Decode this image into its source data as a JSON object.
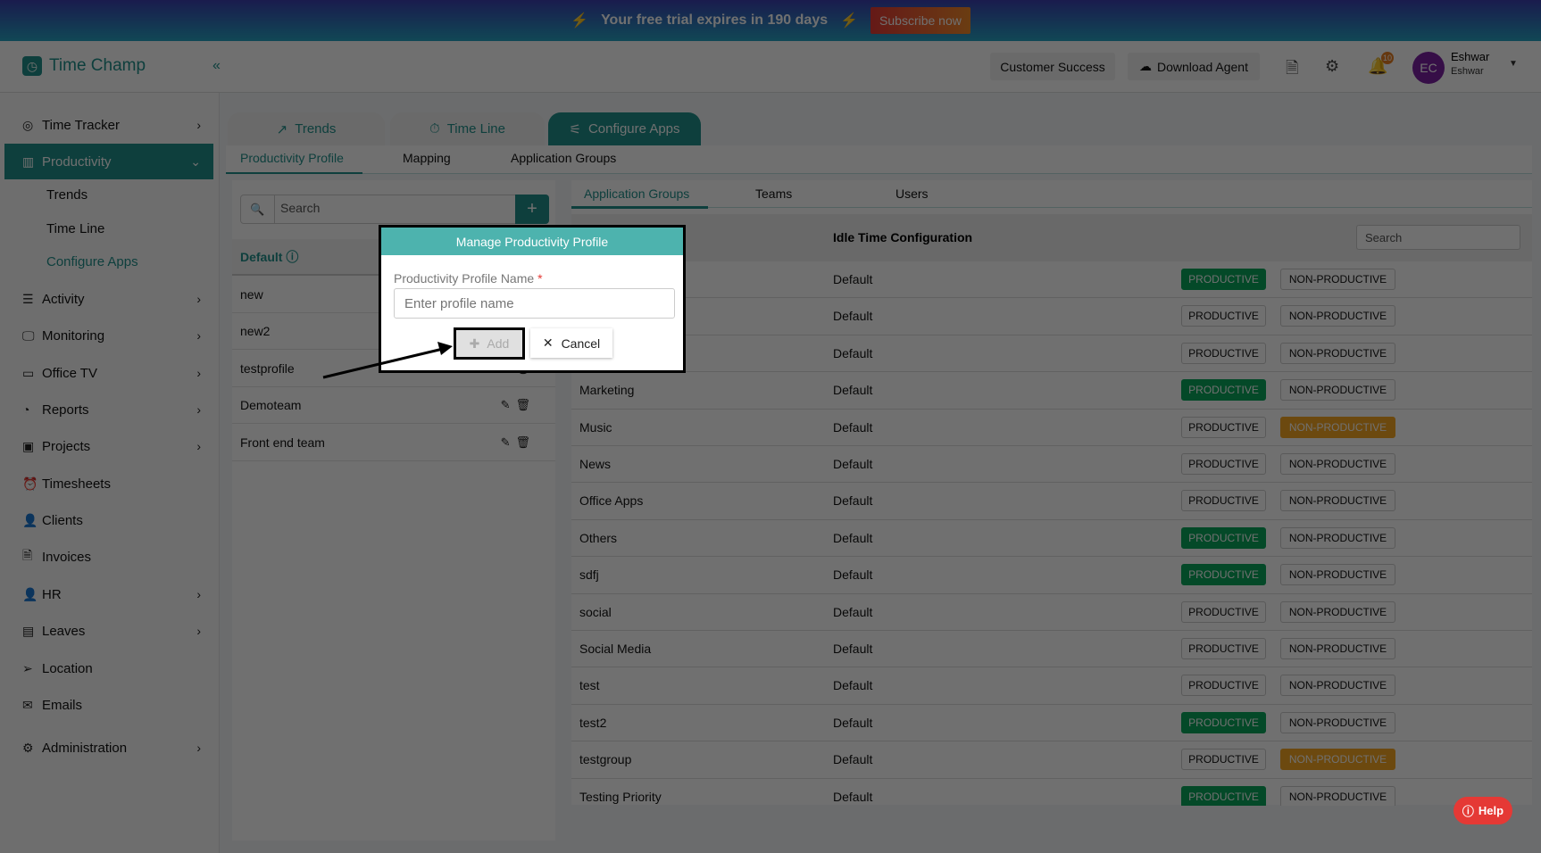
{
  "banner": {
    "text": "Your free trial expires in 190 days",
    "subscribe": "Subscribe now"
  },
  "header": {
    "logo": "Time Champ",
    "collapse": "«",
    "customer_success": "Customer Success",
    "download_agent": "Download Agent",
    "notif_count": "10",
    "avatar": "EC",
    "user_name": "Eshwar",
    "user_sub": "Eshwar"
  },
  "sidebar": {
    "items": [
      "Time Tracker",
      "Productivity",
      "Activity",
      "Monitoring",
      "Office TV",
      "Reports",
      "Projects",
      "Timesheets",
      "Clients",
      "Invoices",
      "HR",
      "Leaves",
      "Location",
      "Emails",
      "Administration"
    ],
    "sub": [
      "Trends",
      "Time Line",
      "Configure Apps"
    ]
  },
  "tabs": [
    "Trends",
    "Time Line",
    "Configure Apps"
  ],
  "subtabs": [
    "Productivity Profile",
    "Mapping",
    "Application Groups"
  ],
  "profiles": {
    "search_placeholder": "Search",
    "default": "Default",
    "items": [
      "new",
      "new2",
      "testprofile",
      "Demoteam",
      "Front end team"
    ]
  },
  "right": {
    "tabs": [
      "Application Groups",
      "Teams",
      "Users"
    ],
    "col_idle": "Idle Time Configuration",
    "search_placeholder": "Search",
    "productive": "PRODUCTIVE",
    "nonproductive": "NON-PRODUCTIVE",
    "rows": [
      {
        "name": "",
        "idle": "Default",
        "status": "P"
      },
      {
        "name": "",
        "idle": "Default",
        "status": ""
      },
      {
        "name": "",
        "idle": "Default",
        "status": ""
      },
      {
        "name": "Marketing",
        "idle": "Default",
        "status": "P"
      },
      {
        "name": "Music",
        "idle": "Default",
        "status": "N"
      },
      {
        "name": "News",
        "idle": "Default",
        "status": ""
      },
      {
        "name": "Office Apps",
        "idle": "Default",
        "status": ""
      },
      {
        "name": "Others",
        "idle": "Default",
        "status": "P"
      },
      {
        "name": "sdfj",
        "idle": "Default",
        "status": "P"
      },
      {
        "name": "social",
        "idle": "Default",
        "status": ""
      },
      {
        "name": "Social Media",
        "idle": "Default",
        "status": ""
      },
      {
        "name": "test",
        "idle": "Default",
        "status": ""
      },
      {
        "name": "test2",
        "idle": "Default",
        "status": "P"
      },
      {
        "name": "testgroup",
        "idle": "Default",
        "status": "N"
      },
      {
        "name": "Testing Priority",
        "idle": "Default",
        "status": "P"
      }
    ]
  },
  "dialog": {
    "title": "Manage Productivity Profile",
    "label": "Productivity Profile Name",
    "required": "*",
    "placeholder": "Enter profile name",
    "add": "Add",
    "cancel": "Cancel"
  },
  "help": "Help"
}
